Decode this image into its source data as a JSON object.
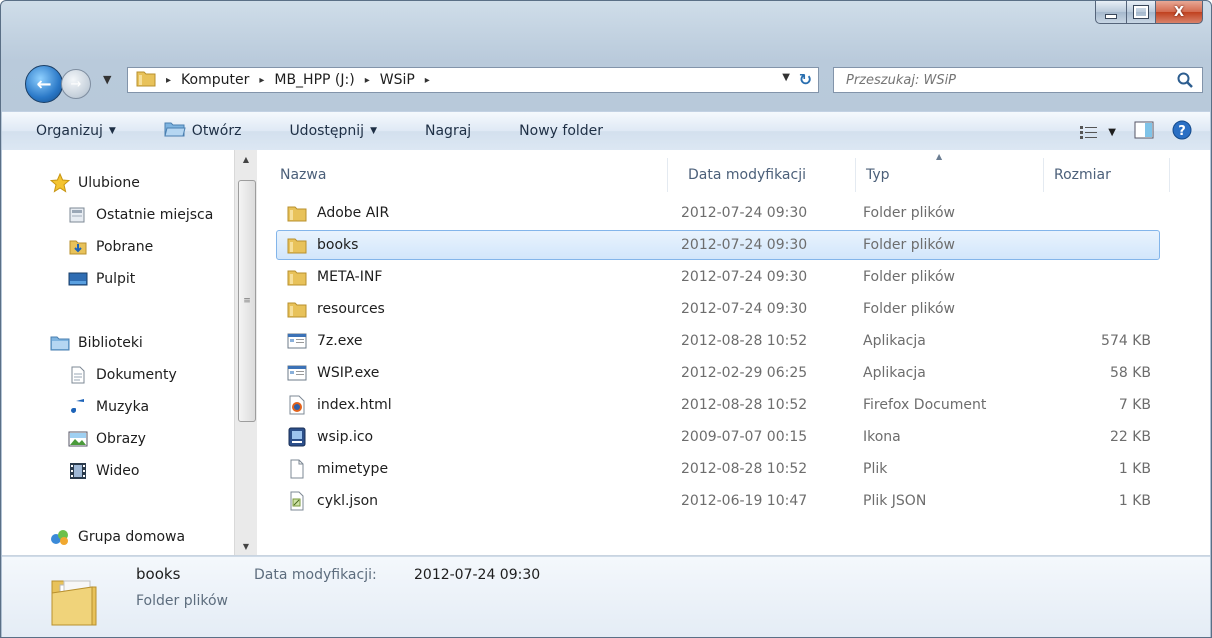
{
  "window": {
    "caption_buttons": {
      "minimize": "",
      "maximize": "",
      "close": "X"
    }
  },
  "address_bar": {
    "crumbs": [
      "Komputer",
      "MB_HPP (J:)",
      "WSiP"
    ],
    "separator": "▸"
  },
  "search": {
    "placeholder": "Przeszukaj: WSiP"
  },
  "command_bar": {
    "organize": "Organizuj",
    "open": "Otwórz",
    "share": "Udostępnij",
    "burn": "Nagraj",
    "new_folder": "Nowy folder"
  },
  "nav_pane": {
    "favorites": "Ulubione",
    "recent": "Ostatnie miejsca",
    "downloads": "Pobrane",
    "desktop": "Pulpit",
    "libraries": "Biblioteki",
    "documents": "Dokumenty",
    "music": "Muzyka",
    "pictures": "Obrazy",
    "videos": "Wideo",
    "homegroup": "Grupa domowa"
  },
  "columns": {
    "name": "Nazwa",
    "date": "Data modyfikacji",
    "type": "Typ",
    "size": "Rozmiar"
  },
  "files": [
    {
      "name": "Adobe AIR",
      "date": "2012-07-24 09:30",
      "type": "Folder plików",
      "size": "",
      "icon": "folder-icon",
      "selected": false
    },
    {
      "name": "books",
      "date": "2012-07-24 09:30",
      "type": "Folder plików",
      "size": "",
      "icon": "folder-icon",
      "selected": true
    },
    {
      "name": "META-INF",
      "date": "2012-07-24 09:30",
      "type": "Folder plików",
      "size": "",
      "icon": "folder-icon",
      "selected": false
    },
    {
      "name": "resources",
      "date": "2012-07-24 09:30",
      "type": "Folder plików",
      "size": "",
      "icon": "folder-icon",
      "selected": false
    },
    {
      "name": "7z.exe",
      "date": "2012-08-28 10:52",
      "type": "Aplikacja",
      "size": "574 KB",
      "icon": "application-icon",
      "selected": false
    },
    {
      "name": "WSIP.exe",
      "date": "2012-02-29 06:25",
      "type": "Aplikacja",
      "size": "58 KB",
      "icon": "application-icon",
      "selected": false
    },
    {
      "name": "index.html",
      "date": "2012-08-28 10:52",
      "type": "Firefox Document",
      "size": "7 KB",
      "icon": "firefox-document-icon",
      "selected": false
    },
    {
      "name": "wsip.ico",
      "date": "2009-07-07 00:15",
      "type": "Ikona",
      "size": "22 KB",
      "icon": "wsip-ico-icon",
      "selected": false
    },
    {
      "name": "mimetype",
      "date": "2012-08-28 10:52",
      "type": "Plik",
      "size": "1 KB",
      "icon": "blank-file-icon",
      "selected": false
    },
    {
      "name": "cykl.json",
      "date": "2012-06-19 10:47",
      "type": "Plik JSON",
      "size": "1 KB",
      "icon": "json-file-icon",
      "selected": false
    }
  ],
  "details_pane": {
    "name": "books",
    "type": "Folder plików",
    "date_label": "Data modyfikacji:",
    "date_value": "2012-07-24 09:30"
  },
  "colors": {
    "selection_bg": "#d2e6fb",
    "selection_border": "#83b5ea",
    "folder": "#e8c25a",
    "accent": "#2a78c7"
  }
}
